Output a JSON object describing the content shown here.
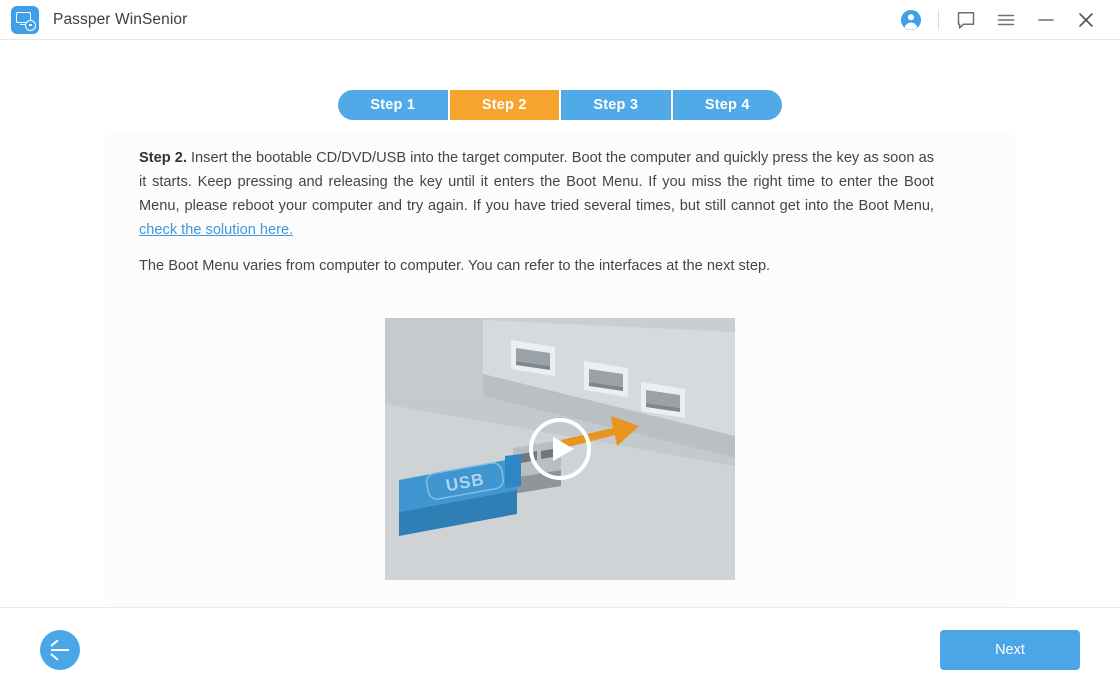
{
  "window": {
    "title": "Passper WinSenior",
    "logo_icon": "monitor-lock-icon",
    "actions": [
      {
        "name": "account-icon",
        "glyph": "account"
      },
      {
        "name": "feedback-icon",
        "glyph": "chat-bubble"
      },
      {
        "name": "menu-icon",
        "glyph": "hamburger"
      },
      {
        "name": "minimize-icon",
        "glyph": "minimize"
      },
      {
        "name": "close-icon",
        "glyph": "close"
      }
    ]
  },
  "steps": [
    {
      "label": "Step 1",
      "active": false
    },
    {
      "label": "Step 2",
      "active": true
    },
    {
      "label": "Step 3",
      "active": false
    },
    {
      "label": "Step 4",
      "active": false
    }
  ],
  "content": {
    "step_label": "Step 2.",
    "paragraph_1": " Insert the bootable CD/DVD/USB into the target computer. Boot the computer and quickly press the key as soon as it starts. Keep pressing and releasing the key until it enters the Boot Menu. If you miss the right time to enter the Boot Menu, please reboot your computer and try again. If you have tried several times, but still cannot get into the Boot Menu, ",
    "link_text": "check the solution here.",
    "paragraph_2": "The Boot Menu varies from computer to computer. You can refer to the interfaces at the next step.",
    "video": {
      "name": "usb-insertion-video-thumbnail",
      "usb_label": "USB",
      "play_icon": "play-icon"
    }
  },
  "footer": {
    "back_icon": "arrow-left-icon",
    "next_label": "Next"
  },
  "colors": {
    "accent_blue": "#4ba6e7",
    "step_blue": "#51a9e8",
    "step_active_orange": "#f5a52e",
    "link_blue": "#3e97dc",
    "text": "#41464c",
    "panel_bg": "#fcfcfc",
    "usb_blue": "#2e87c4",
    "arrow_orange": "#e8941f"
  }
}
